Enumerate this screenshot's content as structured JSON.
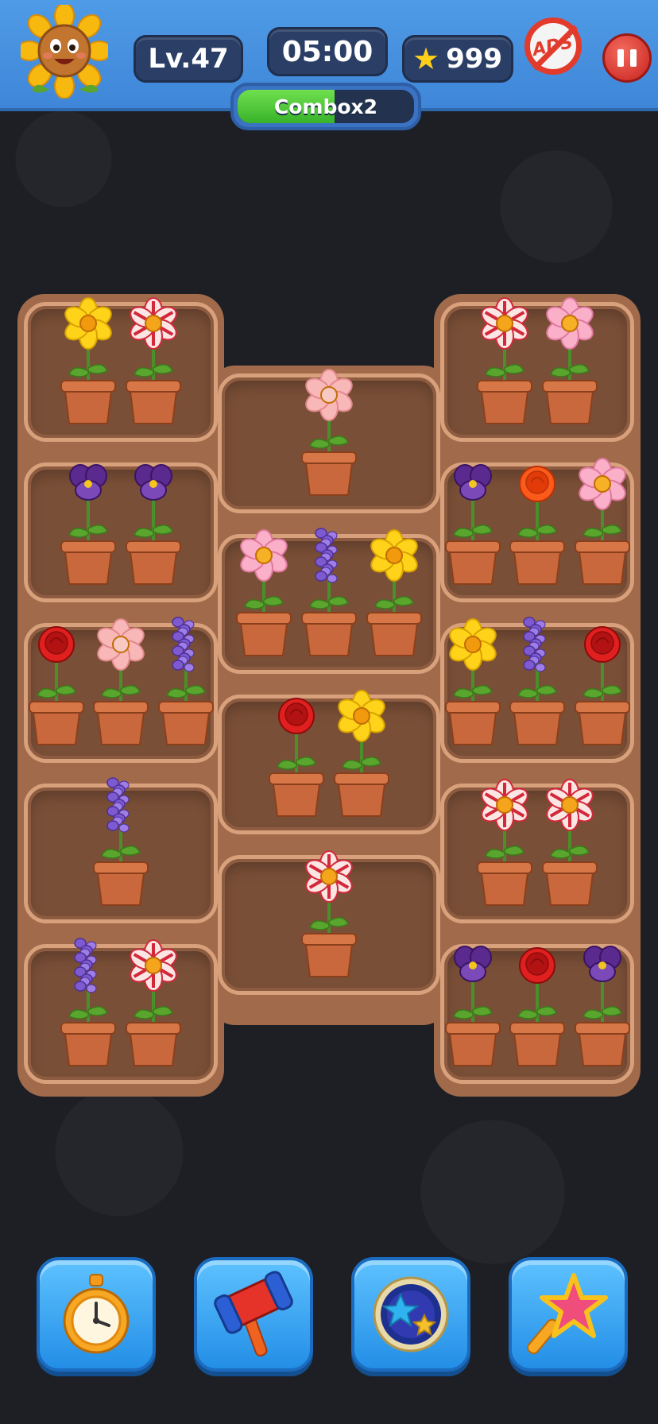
{
  "hud": {
    "level": "Lv.47",
    "timer": "05:00",
    "coins": "999",
    "ads_label": "ADS",
    "combo_label": "Combox2",
    "combo_progress": 0.55
  },
  "icons": {
    "avatar": "sunflower-mascot-icon",
    "coin": "star-icon",
    "ads": "no-ads-icon",
    "pause": "pause-icon"
  },
  "board": {
    "shelves": [
      {
        "name": "shelf-1-left",
        "flowers": [
          "yellow-buttercup",
          "striped-zinnia"
        ]
      },
      {
        "name": "shelf-1-center",
        "flowers": [
          "pink-peony"
        ]
      },
      {
        "name": "shelf-1-right",
        "flowers": [
          "striped-zinnia",
          "pink-cosmos"
        ]
      },
      {
        "name": "shelf-2-left",
        "flowers": [
          "purple-pansy",
          "purple-pansy"
        ]
      },
      {
        "name": "shelf-2-center",
        "flowers": [
          "pink-cosmos",
          "lavender",
          "yellow-buttercup"
        ]
      },
      {
        "name": "shelf-2-right",
        "flowers": [
          "purple-pansy",
          "orange-dahlia",
          "pink-cosmos"
        ]
      },
      {
        "name": "shelf-3-left",
        "flowers": [
          "red-rose",
          "pink-peony",
          "lavender"
        ]
      },
      {
        "name": "shelf-3-center",
        "flowers": [
          "red-rose",
          "yellow-buttercup"
        ]
      },
      {
        "name": "shelf-3-right",
        "flowers": [
          "yellow-buttercup",
          "lavender",
          "red-rose"
        ]
      },
      {
        "name": "shelf-4-left",
        "flowers": [
          "lavender"
        ]
      },
      {
        "name": "shelf-4-center",
        "flowers": [
          "striped-zinnia"
        ]
      },
      {
        "name": "shelf-4-right",
        "flowers": [
          "striped-zinnia",
          "striped-zinnia"
        ]
      },
      {
        "name": "shelf-5-left",
        "flowers": [
          "lavender",
          "striped-zinnia"
        ]
      },
      {
        "name": "shelf-5-right",
        "flowers": [
          "purple-pansy",
          "red-rose",
          "purple-pansy"
        ]
      }
    ]
  },
  "tools": [
    {
      "name": "stopwatch-button",
      "icon": "stopwatch-icon"
    },
    {
      "name": "hammer-button",
      "icon": "hammer-icon"
    },
    {
      "name": "shuffle-orb-button",
      "icon": "star-orb-icon"
    },
    {
      "name": "magic-wand-button",
      "icon": "magic-wand-icon"
    }
  ],
  "colors": {
    "topbar": "#4f9be6",
    "board": "#7a4f37",
    "pot": "#c8683c",
    "tool_button": "#2e9bf0"
  }
}
